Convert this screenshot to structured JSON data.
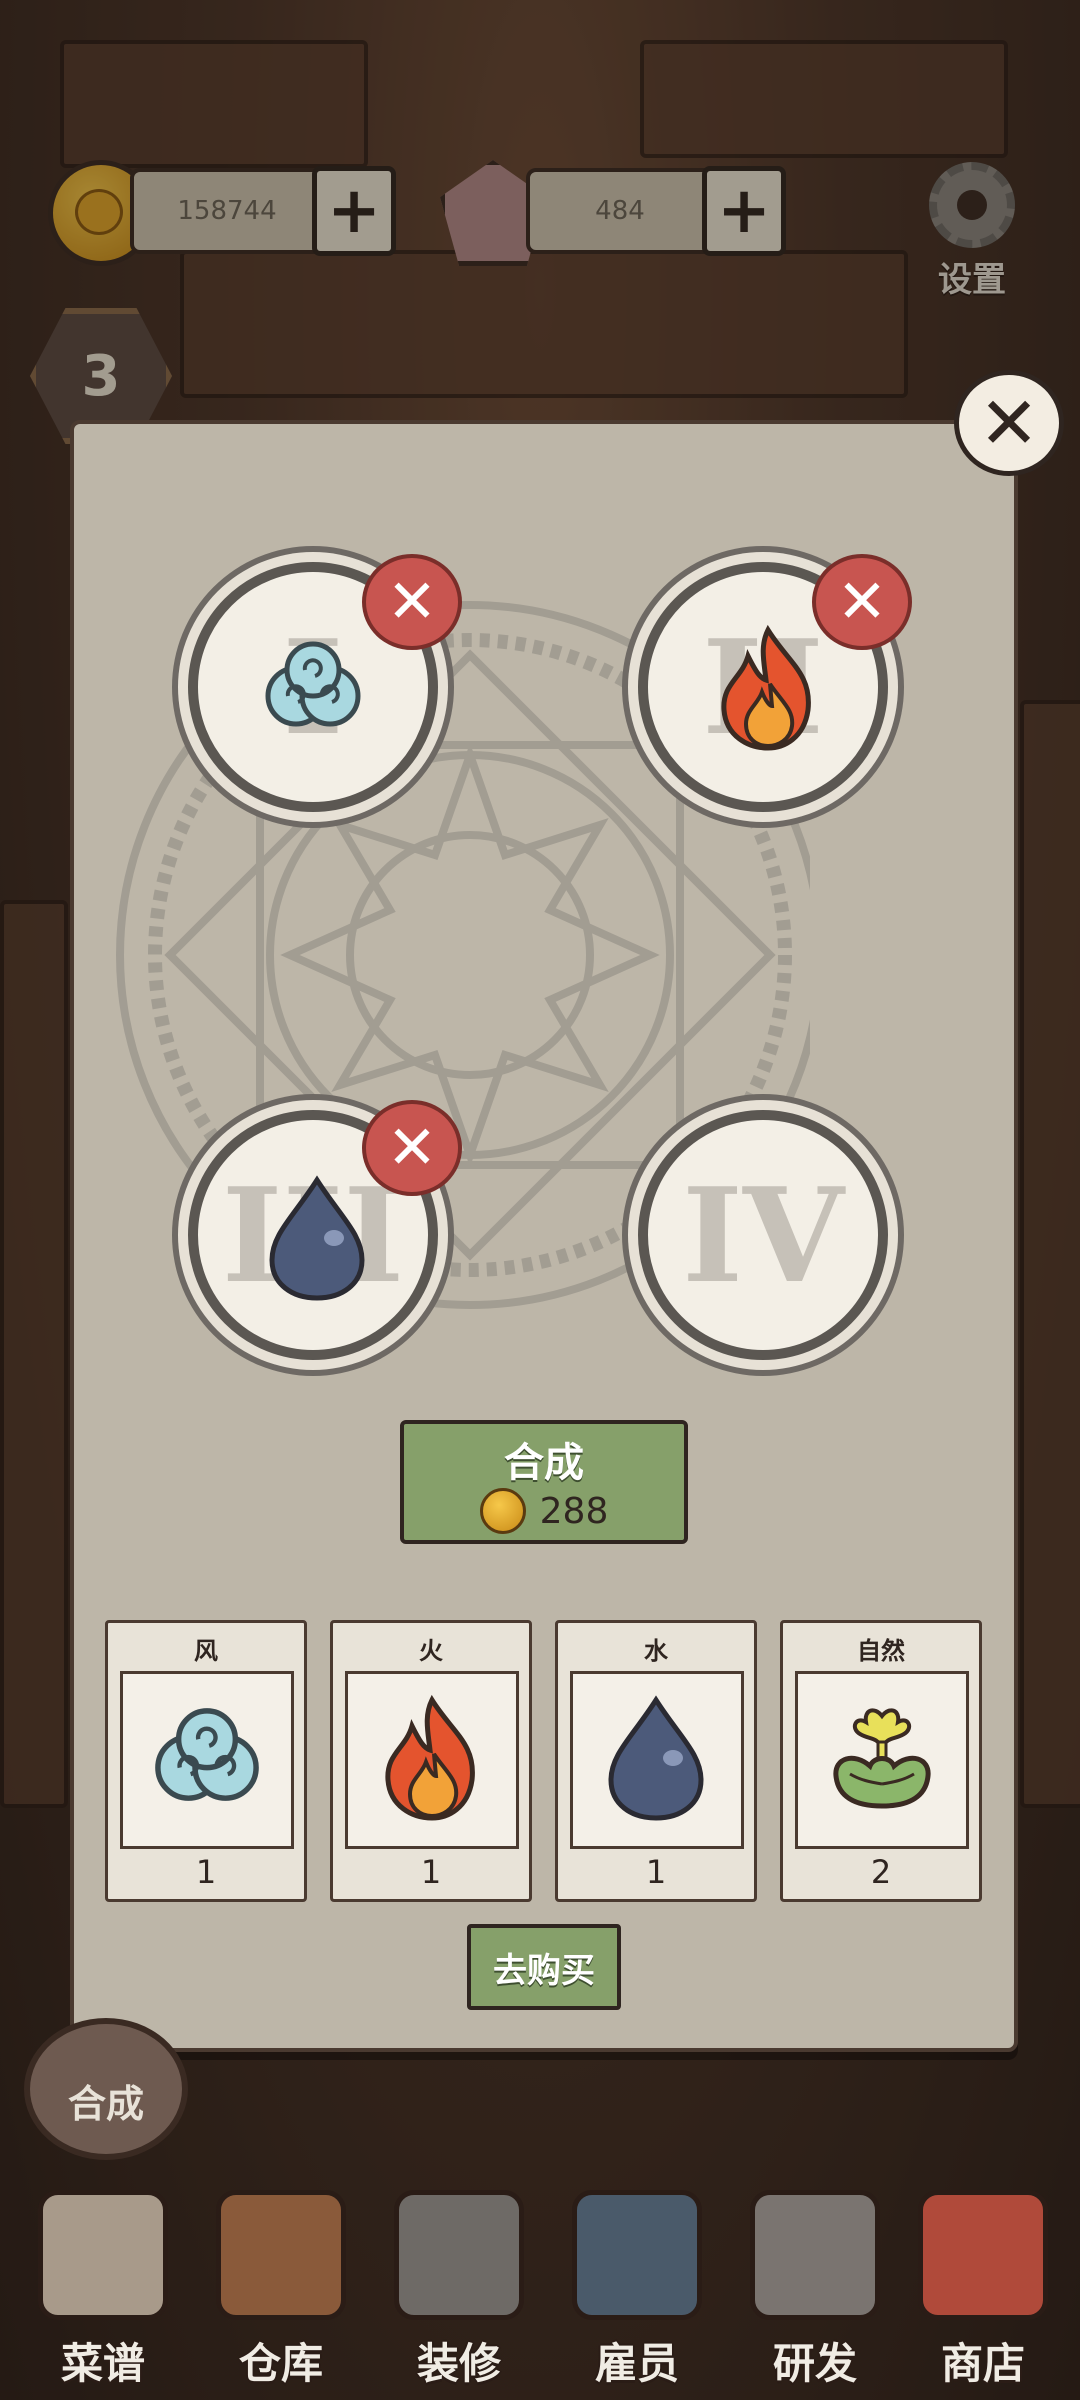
{
  "resources": {
    "coins": "158744",
    "gems": "484",
    "plus_label": "+"
  },
  "settings_label": "设置",
  "level": "3",
  "dialog": {
    "close_label": "✕",
    "slots": [
      {
        "roman": "I",
        "element": "wind-icon",
        "removable": true
      },
      {
        "roman": "II",
        "element": "fire-icon",
        "removable": true
      },
      {
        "roman": "III",
        "element": "water-icon",
        "removable": true
      },
      {
        "roman": "IV",
        "element": "",
        "removable": false
      }
    ],
    "remove_label": "✕",
    "synth_button": {
      "title": "合成",
      "cost": "288"
    },
    "inventory": [
      {
        "name": "风",
        "icon": "wind-icon",
        "count": "1"
      },
      {
        "name": "火",
        "icon": "fire-icon",
        "count": "1"
      },
      {
        "name": "水",
        "icon": "water-icon",
        "count": "1"
      },
      {
        "name": "自然",
        "icon": "nature-icon",
        "count": "2"
      }
    ],
    "buy_label": "去购买"
  },
  "synth_badge_label": "合成",
  "nav": [
    {
      "label": "菜谱",
      "icon": "recipe-scroll-icon",
      "color": "#a89a8a"
    },
    {
      "label": "仓库",
      "icon": "warehouse-cabinet-icon",
      "color": "#8a5a3a"
    },
    {
      "label": "装修",
      "icon": "hammer-icon",
      "color": "#6e6a66"
    },
    {
      "label": "雇员",
      "icon": "employee-portrait-icon",
      "color": "#4a5a6a"
    },
    {
      "label": "研发",
      "icon": "cauldron-icon",
      "color": "#7a7470"
    },
    {
      "label": "商店",
      "icon": "shop-coin-bag-icon",
      "color": "#b04a3a"
    }
  ],
  "colors": {
    "panel": "#bdb6a8",
    "button_green": "#86a06a",
    "remove_red": "#c85550",
    "ink": "#2f2520"
  }
}
